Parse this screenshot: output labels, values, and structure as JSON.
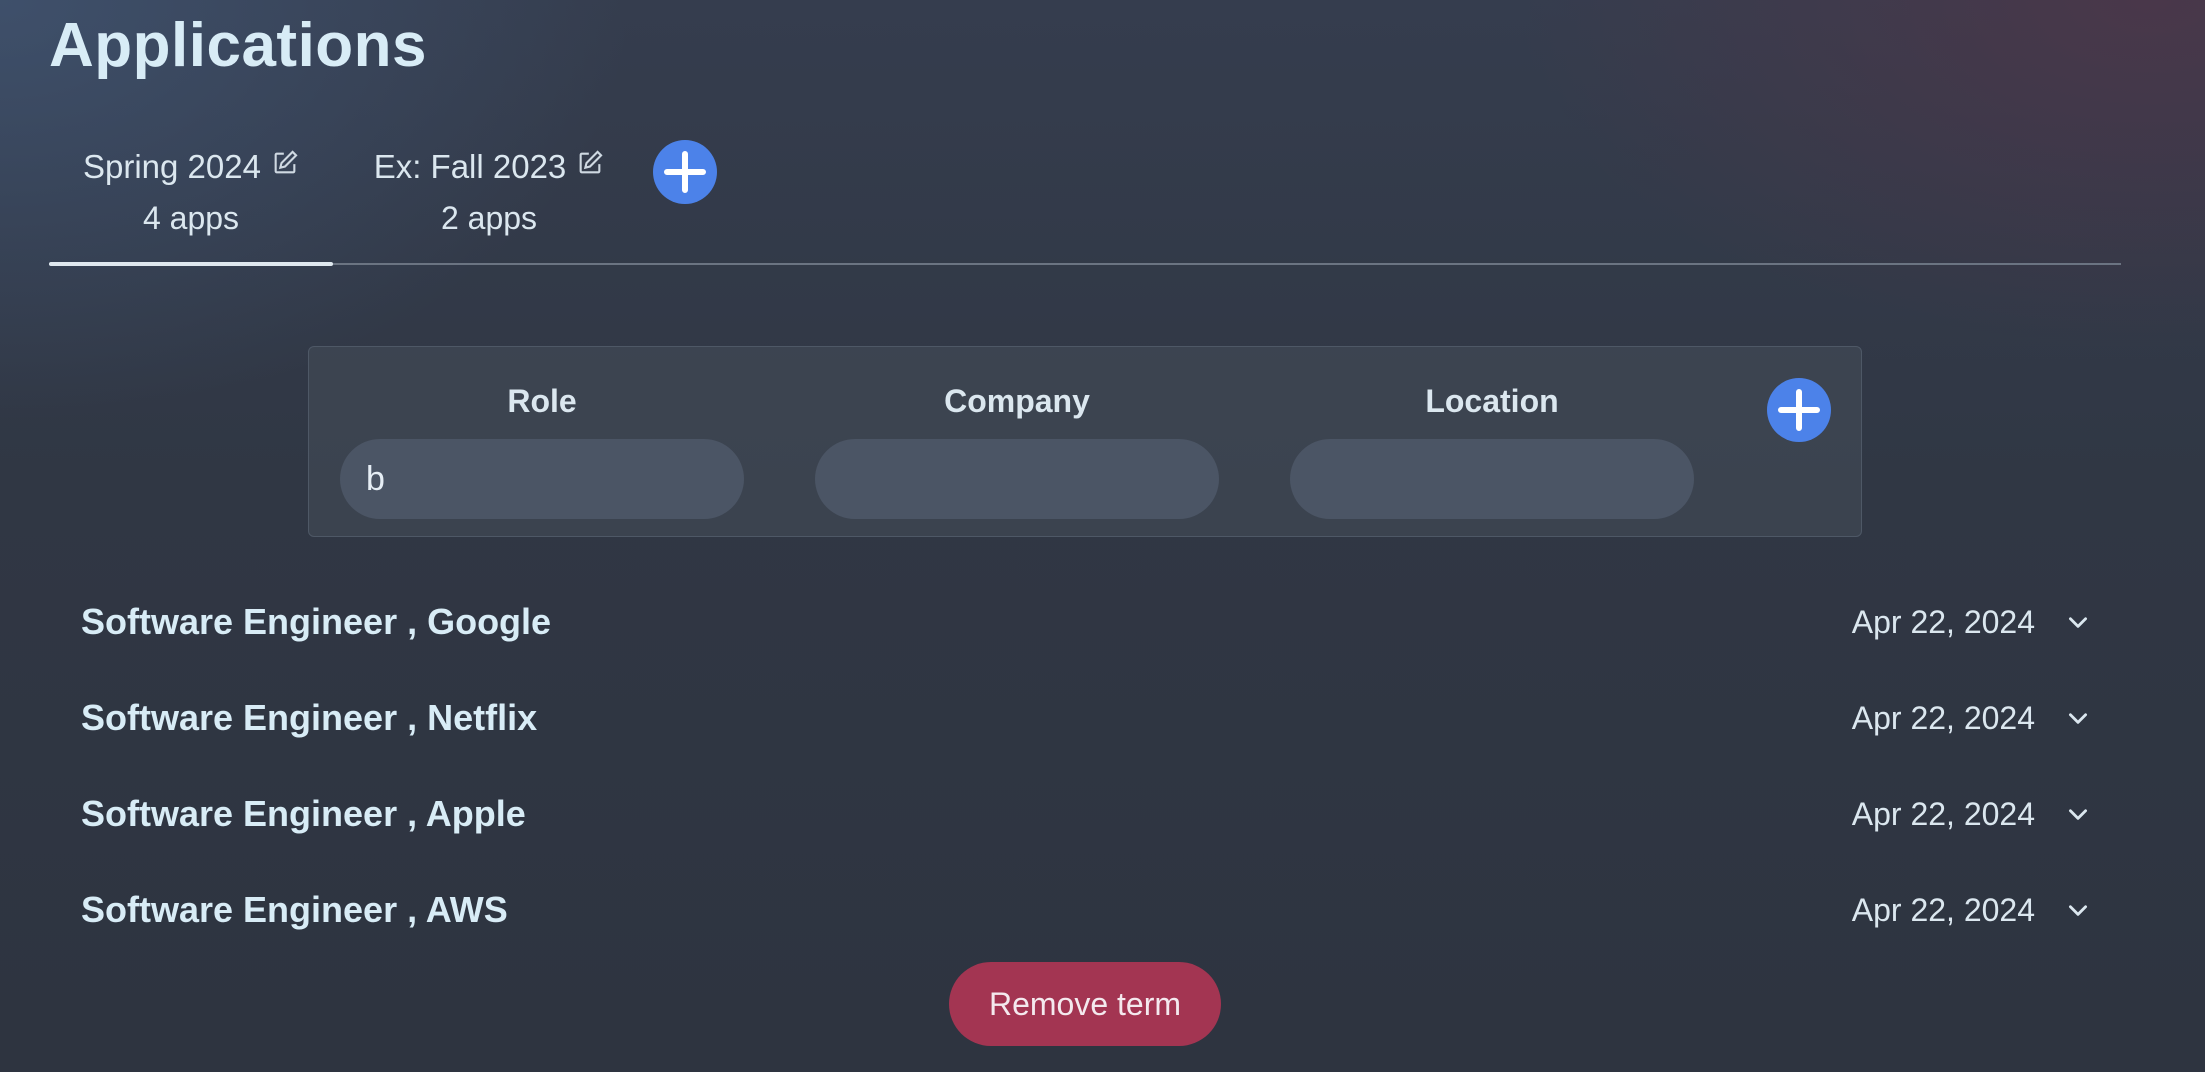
{
  "page": {
    "title": "Applications"
  },
  "tabs": [
    {
      "name": "Spring 2024",
      "count": "4 apps",
      "active": true
    },
    {
      "name": "Ex: Fall 2023",
      "count": "2 apps",
      "active": false
    }
  ],
  "form": {
    "role": {
      "label": "Role",
      "value": "b",
      "placeholder": ""
    },
    "company": {
      "label": "Company",
      "value": "",
      "placeholder": ""
    },
    "location": {
      "label": "Location",
      "value": "",
      "placeholder": ""
    }
  },
  "applications": [
    {
      "title": "Software Engineer , Google",
      "date": "Apr 22, 2024"
    },
    {
      "title": "Software Engineer , Netflix",
      "date": "Apr 22, 2024"
    },
    {
      "title": "Software Engineer , Apple",
      "date": "Apr 22, 2024"
    },
    {
      "title": "Software Engineer , AWS",
      "date": "Apr 22, 2024"
    }
  ],
  "actions": {
    "remove_term_label": "Remove term"
  },
  "icons": {
    "edit": "edit-icon",
    "add": "plus-icon",
    "expand": "chevron-down-icon"
  },
  "colors": {
    "accent": "#4c82e9",
    "danger": "#a33552"
  }
}
